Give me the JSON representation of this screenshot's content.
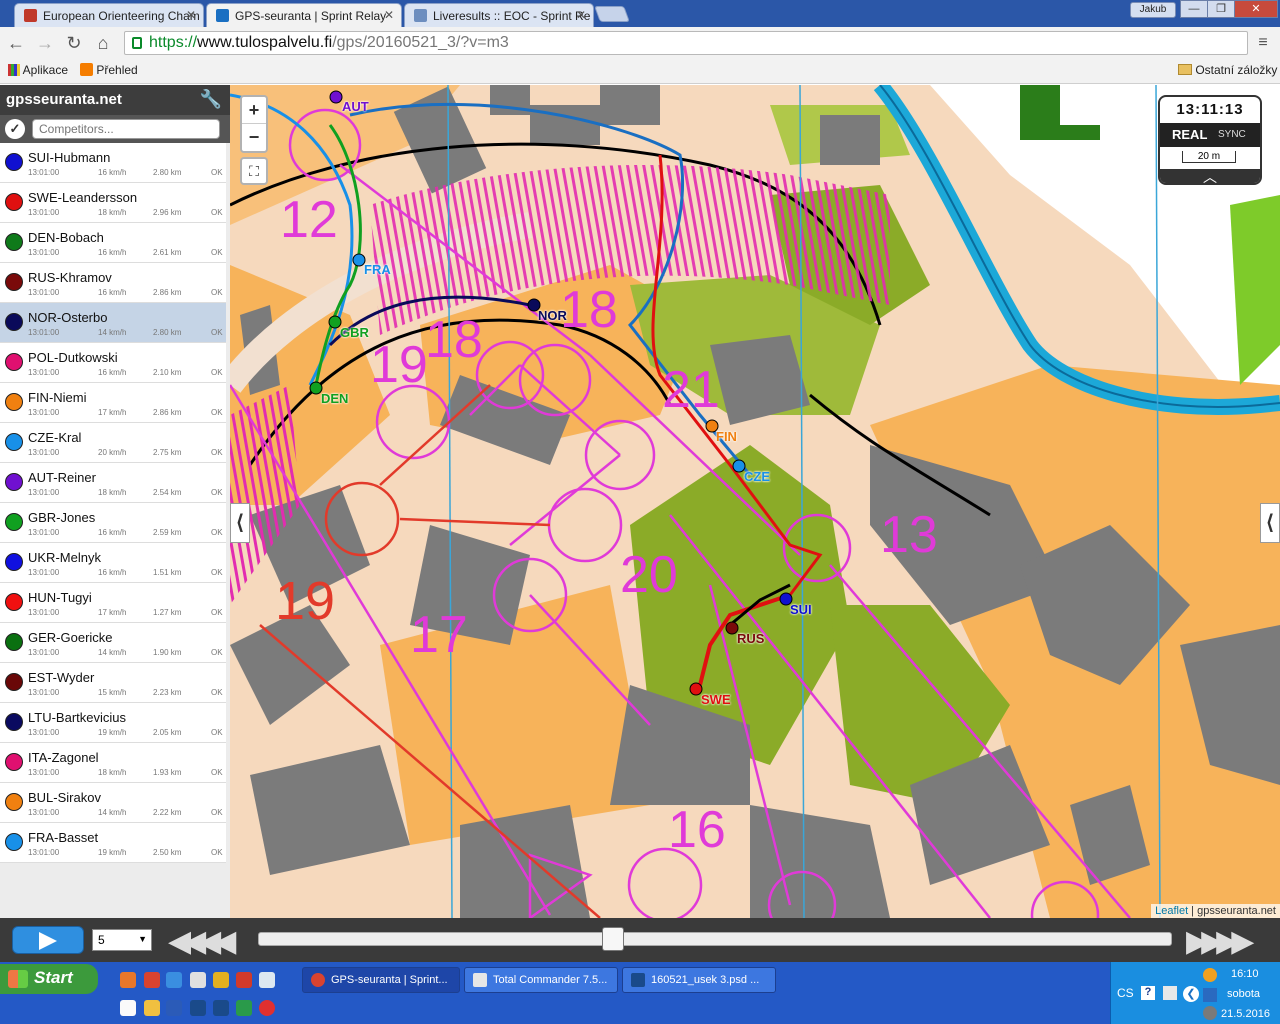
{
  "browser": {
    "tabs": [
      {
        "title": "European Orienteering Cham",
        "color": "#c0392b"
      },
      {
        "title": "GPS-seuranta | Sprint Relay",
        "color": "#1a6fc2"
      },
      {
        "title": "Liveresults :: EOC - Sprint Re",
        "color": "#6d8ebf"
      }
    ],
    "user": "Jakub",
    "url_scheme": "https://",
    "url_domain": "www.tulospalvelu.fi",
    "url_path": "/gps/20160521_3/?v=m3",
    "bookmarks": {
      "apps": "Aplikace",
      "prehled": "Přehled",
      "other": "Ostatní záložky"
    }
  },
  "sidebar": {
    "title": "gpsseuranta.net",
    "search_placeholder": "Competitors...",
    "competitors": [
      {
        "name": "SUI-Hubmann",
        "time": "13:01:00",
        "speed": "16 km/h",
        "dist": "2.80 km",
        "status": "OK",
        "color": "#1010d0"
      },
      {
        "name": "SWE-Leandersson",
        "time": "13:01:00",
        "speed": "18 km/h",
        "dist": "2.96 km",
        "status": "OK",
        "color": "#e01010"
      },
      {
        "name": "DEN-Bobach",
        "time": "13:01:00",
        "speed": "16 km/h",
        "dist": "2.61 km",
        "status": "OK",
        "color": "#0f7a1a"
      },
      {
        "name": "RUS-Khramov",
        "time": "13:01:00",
        "speed": "16 km/h",
        "dist": "2.86 km",
        "status": "OK",
        "color": "#7a0a0a"
      },
      {
        "name": "NOR-Osterbo",
        "time": "13:01:00",
        "speed": "14 km/h",
        "dist": "2.80 km",
        "status": "OK",
        "color": "#0a0a5a"
      },
      {
        "name": "POL-Dutkowski",
        "time": "13:01:00",
        "speed": "16 km/h",
        "dist": "2.10 km",
        "status": "OK",
        "color": "#e01070"
      },
      {
        "name": "FIN-Niemi",
        "time": "13:01:00",
        "speed": "17 km/h",
        "dist": "2.86 km",
        "status": "OK",
        "color": "#f08010"
      },
      {
        "name": "CZE-Kral",
        "time": "13:01:00",
        "speed": "20 km/h",
        "dist": "2.75 km",
        "status": "OK",
        "color": "#1890e8"
      },
      {
        "name": "AUT-Reiner",
        "time": "13:01:00",
        "speed": "18 km/h",
        "dist": "2.54 km",
        "status": "OK",
        "color": "#7010d0"
      },
      {
        "name": "GBR-Jones",
        "time": "13:01:00",
        "speed": "16 km/h",
        "dist": "2.59 km",
        "status": "OK",
        "color": "#10a020"
      },
      {
        "name": "UKR-Melnyk",
        "time": "13:01:00",
        "speed": "16 km/h",
        "dist": "1.51 km",
        "status": "OK",
        "color": "#1010e0"
      },
      {
        "name": "HUN-Tugyi",
        "time": "13:01:00",
        "speed": "17 km/h",
        "dist": "1.27 km",
        "status": "OK",
        "color": "#f01010"
      },
      {
        "name": "GER-Goericke",
        "time": "13:01:00",
        "speed": "14 km/h",
        "dist": "1.90 km",
        "status": "OK",
        "color": "#0a7010"
      },
      {
        "name": "EST-Wyder",
        "time": "13:01:00",
        "speed": "15 km/h",
        "dist": "2.23 km",
        "status": "OK",
        "color": "#6a0808"
      },
      {
        "name": "LTU-Bartkevicius",
        "time": "13:01:00",
        "speed": "19 km/h",
        "dist": "2.05 km",
        "status": "OK",
        "color": "#0a0a60"
      },
      {
        "name": "ITA-Zagonel",
        "time": "13:01:00",
        "speed": "18 km/h",
        "dist": "1.93 km",
        "status": "OK",
        "color": "#e01070"
      },
      {
        "name": "BUL-Sirakov",
        "time": "13:01:00",
        "speed": "14 km/h",
        "dist": "2.22 km",
        "status": "OK",
        "color": "#f08010"
      },
      {
        "name": "FRA-Basset",
        "time": "13:01:00",
        "speed": "19 km/h",
        "dist": "2.50 km",
        "status": "OK",
        "color": "#1890e8"
      }
    ]
  },
  "map": {
    "clock": "13:11:13",
    "real": "REAL",
    "sync": "SYNC",
    "scale": "20 m",
    "zoom_in": "+",
    "zoom_out": "−",
    "attribution_leaflet": "Leaflet",
    "attribution_rest": " | gpsseuranta.net",
    "control_numbers": [
      {
        "n": "12"
      },
      {
        "n": "18"
      },
      {
        "n": "18"
      },
      {
        "n": "19"
      },
      {
        "n": "21"
      },
      {
        "n": "13"
      },
      {
        "n": "20"
      },
      {
        "n": "19"
      },
      {
        "n": "17"
      },
      {
        "n": "16"
      }
    ],
    "runner_labels": [
      "AUT",
      "FRA",
      "GBR",
      "DEN",
      "NOR",
      "FIN",
      "CZE",
      "SUI",
      "RUS",
      "SWE"
    ]
  },
  "player": {
    "speed": "5"
  },
  "taskbar": {
    "start": "Start",
    "tasks": [
      "GPS-seuranta | Sprint...",
      "Total Commander 7.5...",
      "160521_usek 3.psd ..."
    ],
    "lang": "CS",
    "time": "16:10",
    "day": "sobota",
    "date": "21.5.2016"
  }
}
